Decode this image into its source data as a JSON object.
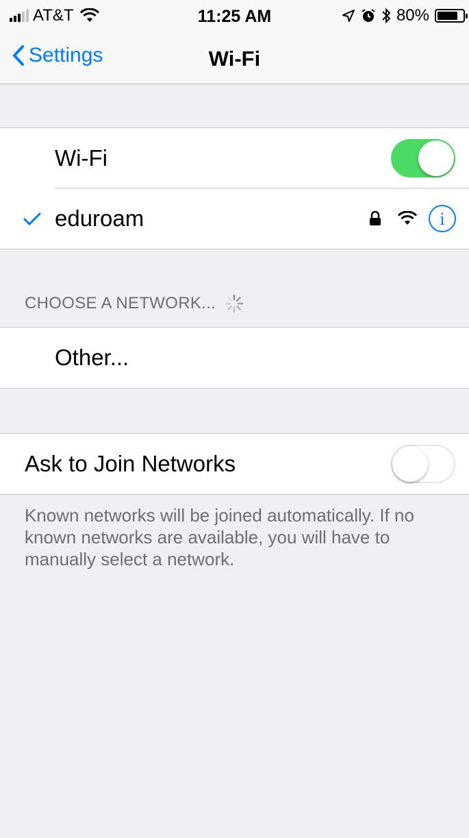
{
  "status_bar": {
    "carrier": "AT&T",
    "time": "11:25 AM",
    "battery_percent": "80%",
    "battery_level": 0.8,
    "icons": [
      "signal-bars-icon",
      "wifi-icon",
      "location-arrow-icon",
      "alarm-icon",
      "bluetooth-icon",
      "battery-icon"
    ]
  },
  "nav": {
    "back_label": "Settings",
    "title": "Wi-Fi"
  },
  "wifi": {
    "label": "Wi-Fi",
    "enabled": true
  },
  "connected_network": {
    "name": "eduroam",
    "secured": true,
    "icons": [
      "checkmark-icon",
      "lock-icon",
      "wifi-strength-icon",
      "info-icon"
    ]
  },
  "choose_network": {
    "header": "CHOOSE A NETWORK...",
    "other_label": "Other..."
  },
  "ask_to_join": {
    "label": "Ask to Join Networks",
    "enabled": false,
    "footer": "Known networks will be joined automatically. If no known networks are available, you will have to manually select a network."
  },
  "colors": {
    "accent": "#007aff",
    "toggle_on": "#4cd964",
    "background": "#efeff4"
  }
}
